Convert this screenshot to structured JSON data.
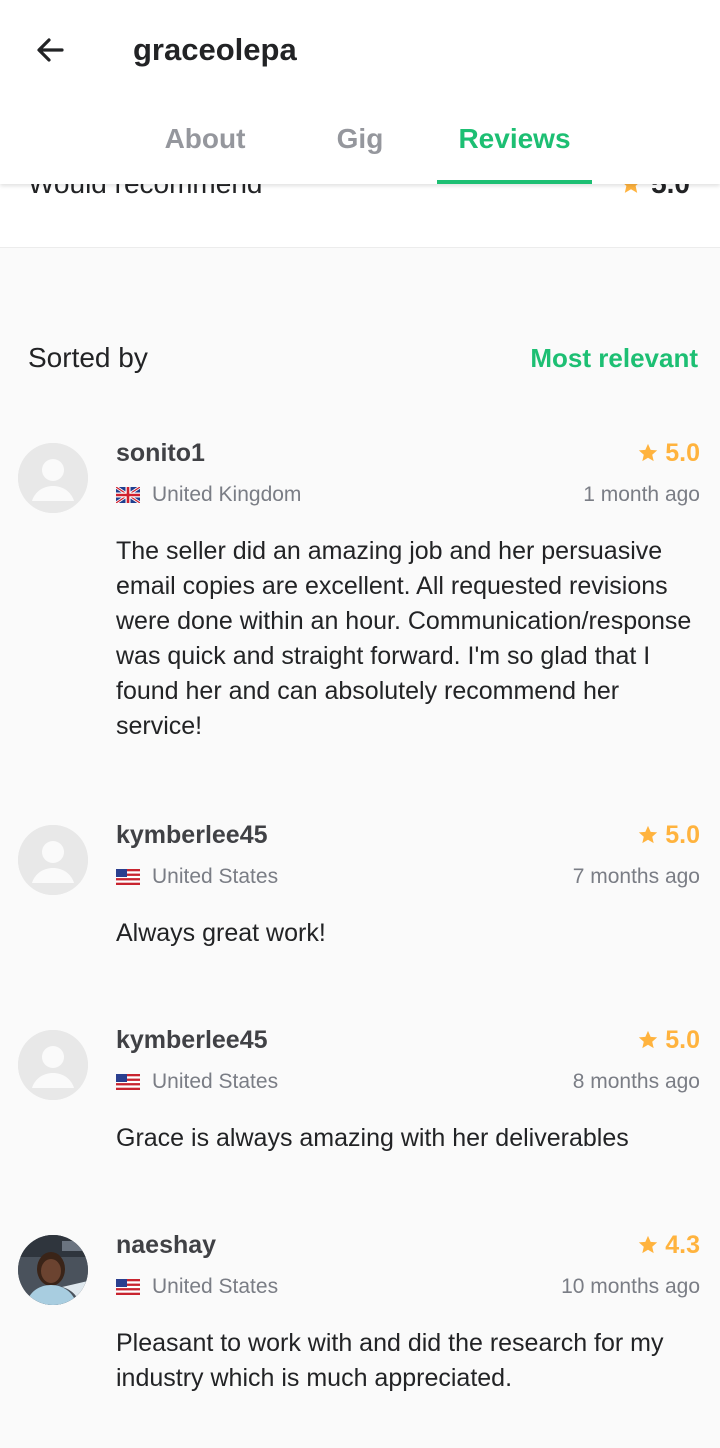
{
  "header": {
    "title": "graceolepa",
    "tabs": [
      {
        "label": "About",
        "active": false
      },
      {
        "label": "Gig",
        "active": false
      },
      {
        "label": "Reviews",
        "active": true
      }
    ]
  },
  "summary": {
    "label": "Would recommend",
    "score": "5.0"
  },
  "sort": {
    "label": "Sorted by",
    "value": "Most relevant"
  },
  "reviews": [
    {
      "username": "sonito1",
      "rating": "5.0",
      "country": "United Kingdom",
      "flag": "uk-flag",
      "time": "1 month ago",
      "text": "The seller did an amazing job and her persuasive email copies are excellent. All requested revisions were done within an hour. Communication/response was quick and straight forward. I'm so glad that I found her and can absolutely recommend her service!",
      "avatar": "placeholder"
    },
    {
      "username": "kymberlee45",
      "rating": "5.0",
      "country": "United States",
      "flag": "us-flag",
      "time": "7 months ago",
      "text": "Always great work!",
      "avatar": "placeholder"
    },
    {
      "username": "kymberlee45",
      "rating": "5.0",
      "country": "United States",
      "flag": "us-flag",
      "time": "8 months ago",
      "text": "Grace is always amazing with her deliverables",
      "avatar": "placeholder"
    },
    {
      "username": "naeshay",
      "rating": "4.3",
      "country": "United States",
      "flag": "us-flag",
      "time": "10 months ago",
      "text": "Pleasant to work with and did the research for my industry which is much appreciated.",
      "avatar": "photo"
    }
  ],
  "colors": {
    "accent": "#1dbf73",
    "star": "#ffb33e",
    "muted": "#7a7d85"
  }
}
